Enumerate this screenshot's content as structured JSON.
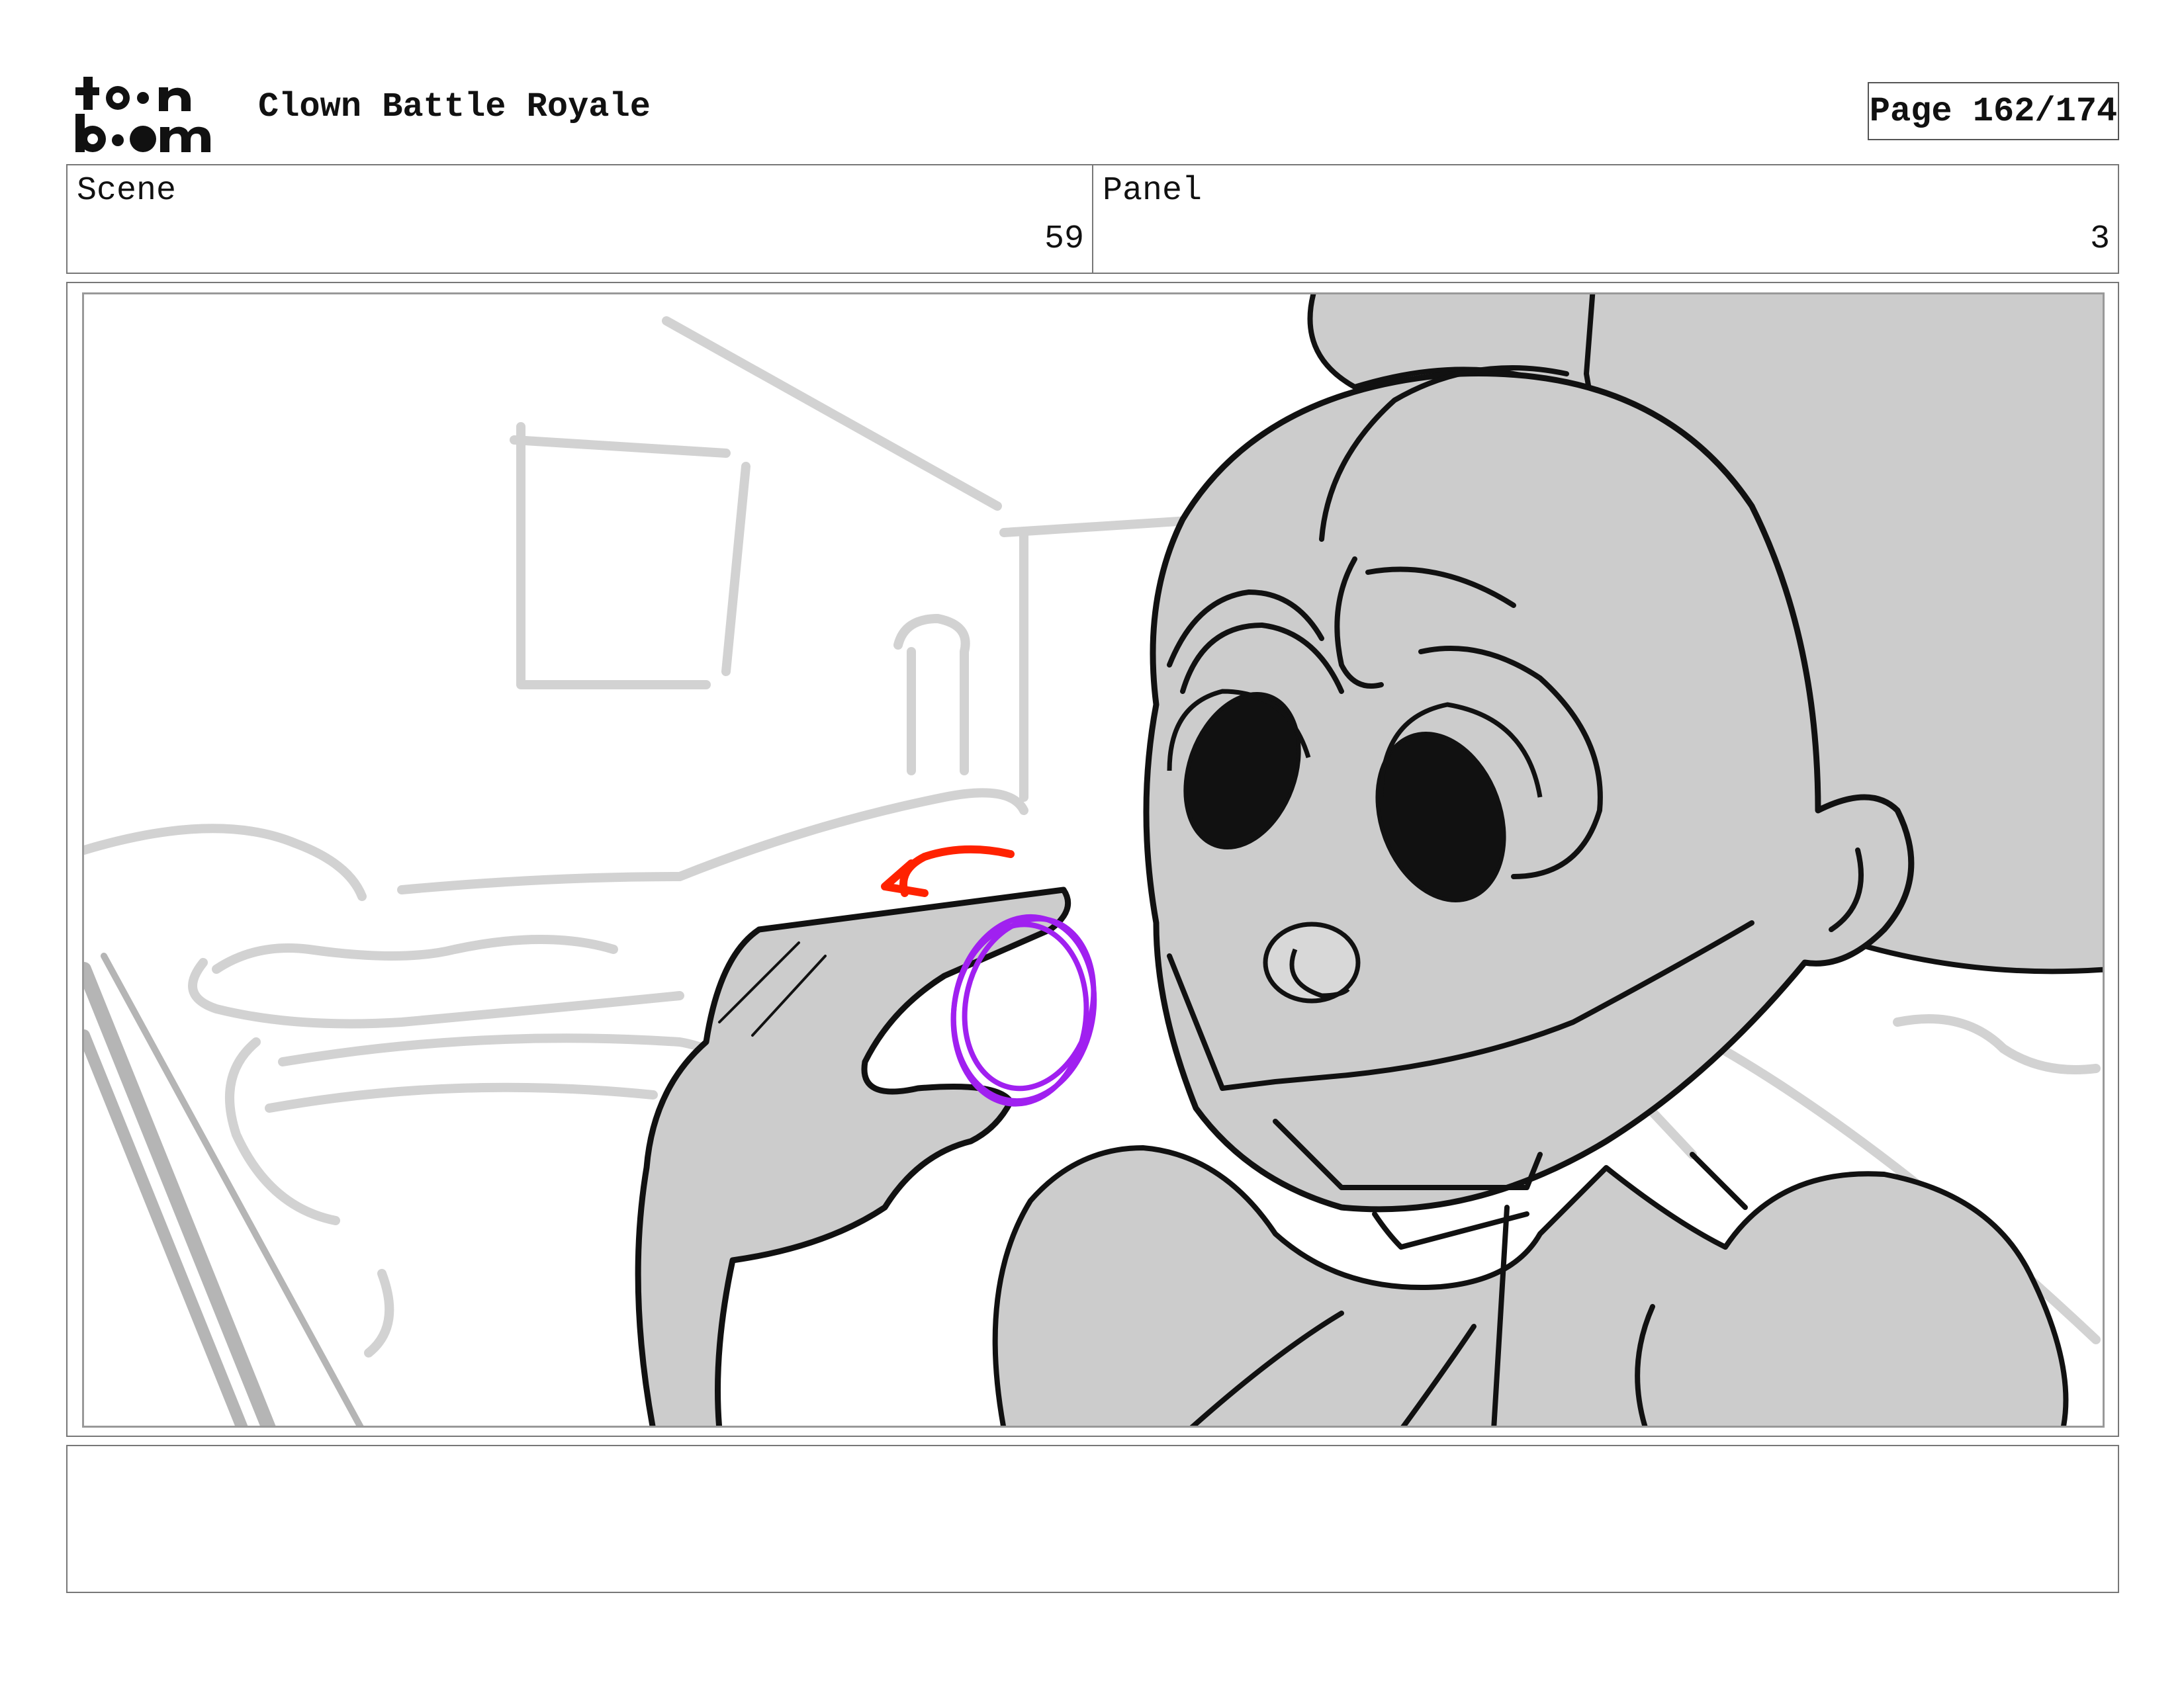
{
  "header": {
    "logo_text_top": "toon",
    "logo_text_bottom": "boom",
    "project_title": "Clown Battle Royale",
    "page_indicator": "Page 162/174"
  },
  "info": {
    "scene_label": "Scene",
    "scene_value": "59",
    "panel_label": "Panel",
    "panel_value": "3"
  },
  "panel": {
    "ink_color": "#111111",
    "fill_color": "#cccccc",
    "background_sketch_color": "#d0d0d0",
    "highlight_circle_color": "#a020f0",
    "motion_arrow_color": "#ff2200"
  },
  "notes": {
    "text": ""
  }
}
